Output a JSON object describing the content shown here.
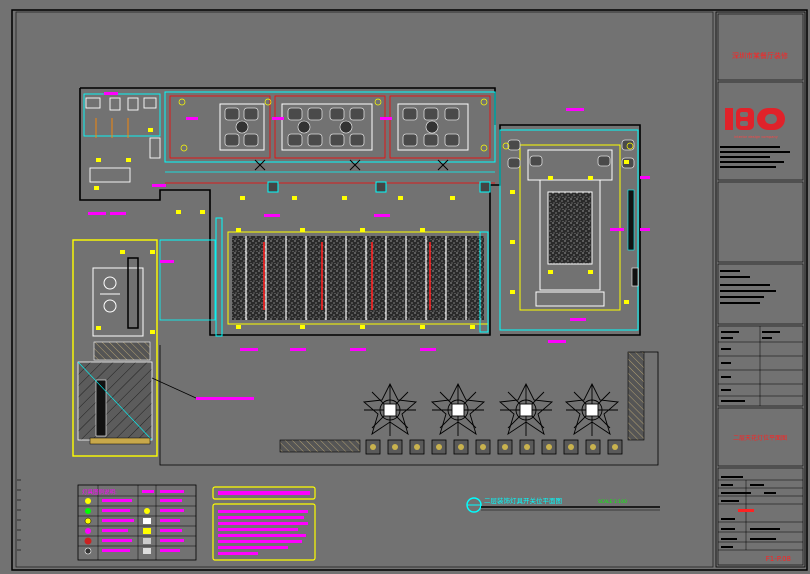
{
  "drawing": {
    "plan_title": "二层装饰灯具开关位平面图",
    "scale_note": "SCALE 1:100",
    "legend_title": "灯具图例说明:",
    "legend_items": [
      "筒灯",
      "射灯",
      "吸顶灯",
      "壁灯",
      "灯带",
      "地灯",
      "格栅灯",
      "应急灯",
      "排气扇"
    ]
  },
  "title_block": {
    "project_name": "深圳市某餐厅装修",
    "company_logo": "IBO",
    "company_sub": "interior design company",
    "sheet_title": "二层天花灯位平面图",
    "sheet_number": "F1-P.08"
  },
  "colors": {
    "background": "#727272",
    "outline": "#000000",
    "cyan": "#00ffff",
    "yellow": "#ffff00",
    "magenta": "#ff00ff",
    "red": "#ff0000",
    "white": "#ffffff"
  }
}
